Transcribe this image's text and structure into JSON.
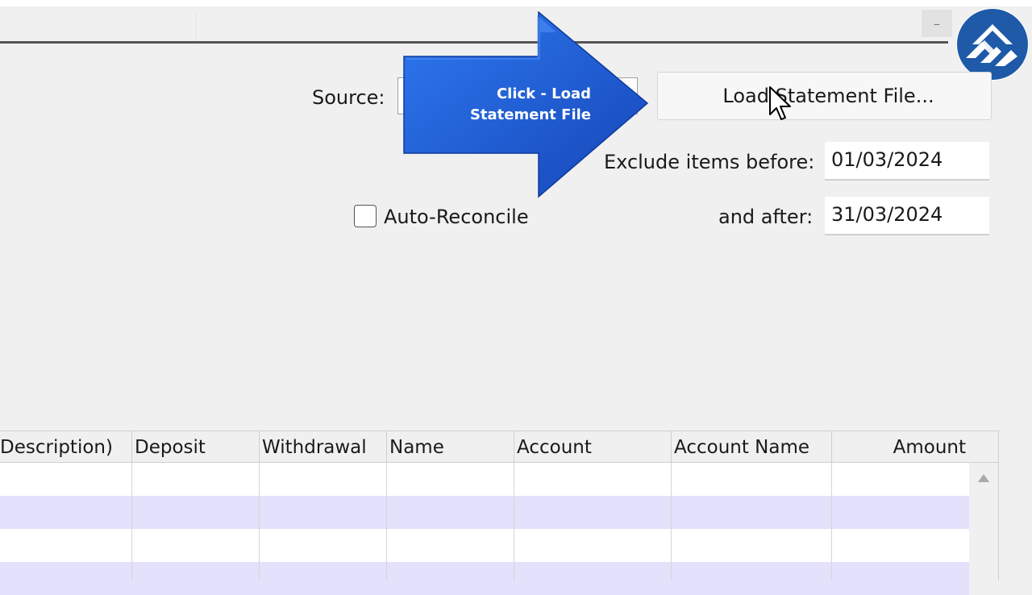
{
  "window": {
    "minimize_glyph": "–"
  },
  "form": {
    "source_label": "Source:",
    "source_value": "",
    "load_button_label": "Load Statement File...",
    "exclude_before_label": "Exclude items before:",
    "exclude_before_value": "01/03/2024",
    "and_after_label": "and after:",
    "and_after_value": "31/03/2024",
    "auto_reconcile_label": "Auto-Reconcile",
    "auto_reconcile_checked": false
  },
  "callout": {
    "line1": "Click - Load",
    "line2": "Statement File",
    "color": "#1a5ad6"
  },
  "table": {
    "columns": [
      "Description)",
      "Deposit",
      "Withdrawal",
      "Name",
      "Account",
      "Account Name",
      "Amount"
    ],
    "row_colors": [
      "#ffffff",
      "#e3e1fb"
    ]
  },
  "icons": [
    "minimize-icon",
    "brand-logo-icon",
    "mouse-pointer-icon",
    "scroll-up-arrow-icon"
  ]
}
